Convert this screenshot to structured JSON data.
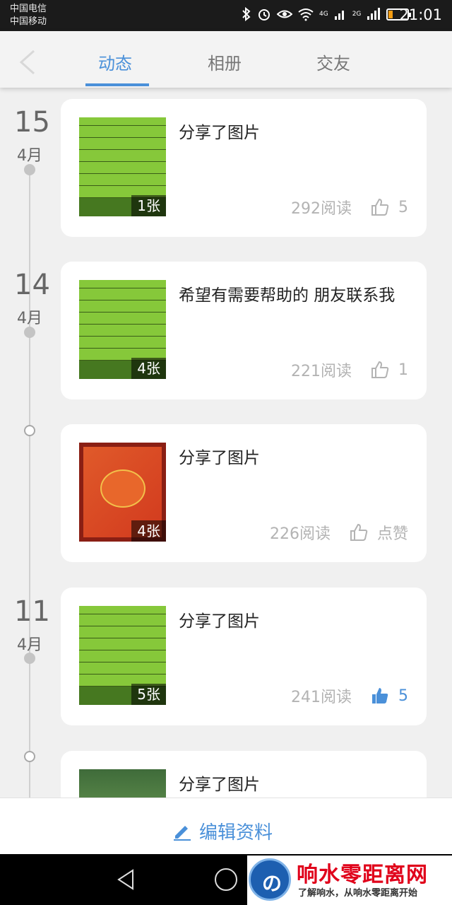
{
  "status_bar": {
    "carrier_1": "中国电信",
    "carrier_2": "中国移动",
    "network_label": "4G",
    "network_label_2": "2G",
    "time": "21:01",
    "battery_color": "#f39c12"
  },
  "tabs": [
    {
      "label": "动态",
      "active": true
    },
    {
      "label": "相册",
      "active": false
    },
    {
      "label": "交友",
      "active": false
    }
  ],
  "accent_color": "#4a90d9",
  "posts": [
    {
      "day": "15",
      "month": "4月",
      "text": "分享了图片",
      "image_count": "1张",
      "reads": "292阅读",
      "likes": "5",
      "liked": false,
      "thumb": "green-flyer"
    },
    {
      "day": "14",
      "month": "4月",
      "text": "希望有需要帮助的 朋友联系我",
      "image_count": "4张",
      "reads": "221阅读",
      "likes": "1",
      "liked": false,
      "thumb": "green-flyer"
    },
    {
      "day": "",
      "month": "",
      "text": "分享了图片",
      "image_count": "4张",
      "reads": "226阅读",
      "likes": "点赞",
      "liked": false,
      "thumb": "red-certificate"
    },
    {
      "day": "11",
      "month": "4月",
      "text": "分享了图片",
      "image_count": "5张",
      "reads": "241阅读",
      "likes": "5",
      "liked": true,
      "thumb": "green-flyer"
    },
    {
      "day": "",
      "month": "",
      "text": "分享了图片",
      "image_count": "",
      "reads": "",
      "likes": "",
      "liked": false,
      "thumb": "photo"
    }
  ],
  "bottom_bar": {
    "edit_label": "编辑资料"
  },
  "watermark": {
    "logo_letter": "の",
    "title": "响水零距离网",
    "subtitle": "了解响水，从响水零距离开始"
  }
}
